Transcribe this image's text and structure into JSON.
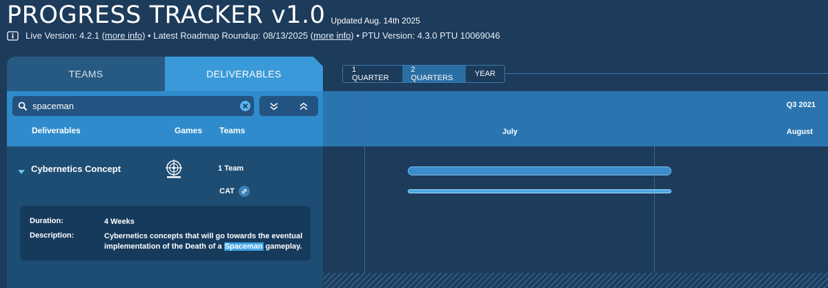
{
  "header": {
    "title": "PROGRESS TRACKER v1.0",
    "updated": "Updated Aug. 14th 2025",
    "live_prefix": "Live Version: 4.2.1 (",
    "live_link": "more info",
    "live_suffix": ") • Latest Roadmap Roundup: 08/13/2025 (",
    "roundup_link": "more info",
    "ptu_text": ") • PTU Version: 4.3.0 PTU 10069046"
  },
  "tabs": [
    {
      "label": "TEAMS"
    },
    {
      "label": "DELIVERABLES"
    }
  ],
  "search": {
    "value": "spaceman",
    "placeholder": ""
  },
  "columns": {
    "deliverables": "Deliverables",
    "games": "Games",
    "teams": "Teams"
  },
  "deliverable": {
    "name": "Cybernetics Concept",
    "game_logo": "star-citizen-logo",
    "team_count": "1 Team",
    "team_name": "CAT",
    "duration_label": "Duration:",
    "duration_value": "4 Weeks",
    "description_label": "Description:",
    "description_before": "Cybernetics concepts that will go towards the eventual implementation of the Death of a ",
    "description_highlight": "Spaceman",
    "description_after": " gameplay."
  },
  "range_buttons": [
    {
      "label": "1 QUARTER",
      "active": false
    },
    {
      "label": "2 QUARTERS",
      "active": true
    },
    {
      "label": "YEAR",
      "active": false
    }
  ],
  "timeline": {
    "quarter": "Q3 2021",
    "months": [
      "July",
      "August"
    ]
  },
  "colors": {
    "background": "#1d3b5b",
    "accent": "#3a9ad9",
    "bar": "#3a8ccc"
  }
}
